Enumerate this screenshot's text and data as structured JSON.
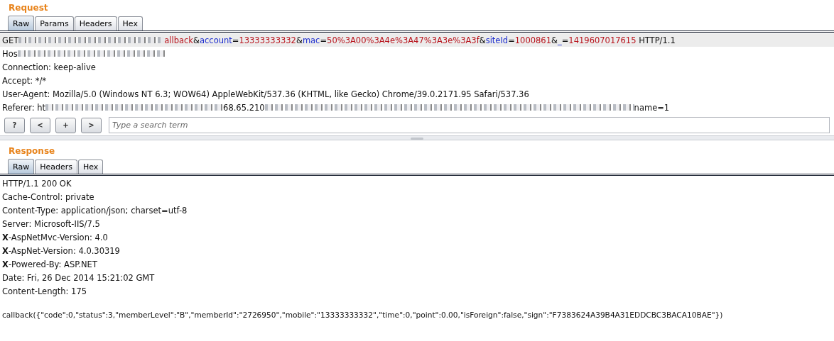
{
  "request": {
    "title": "Request",
    "tabs": [
      {
        "label": "Raw",
        "selected": true
      },
      {
        "label": "Params",
        "selected": false
      },
      {
        "label": "Headers",
        "selected": false
      },
      {
        "label": "Hex",
        "selected": false
      }
    ],
    "lines": [
      {
        "highlighted": true,
        "segments": [
          {
            "kind": "text",
            "parts": [
              {
                "kind": "plain",
                "text": "GET"
              }
            ]
          },
          {
            "kind": "redacted"
          },
          {
            "kind": "text",
            "parts": [
              {
                "kind": "value",
                "text": "allback"
              },
              {
                "kind": "plain",
                "text": "&"
              },
              {
                "kind": "name",
                "text": "account"
              },
              {
                "kind": "plain",
                "text": "="
              },
              {
                "kind": "value",
                "text": "13333333332"
              },
              {
                "kind": "plain",
                "text": "&"
              },
              {
                "kind": "name",
                "text": "mac"
              },
              {
                "kind": "plain",
                "text": "="
              },
              {
                "kind": "value",
                "text": "50%3A00%3A4e%3A47%3A3e%3A3f"
              },
              {
                "kind": "plain",
                "text": "&"
              },
              {
                "kind": "name",
                "text": "siteId"
              },
              {
                "kind": "plain",
                "text": "="
              },
              {
                "kind": "value",
                "text": "1000861"
              },
              {
                "kind": "plain",
                "text": "&"
              },
              {
                "kind": "name",
                "text": "_"
              },
              {
                "kind": "plain",
                "text": "="
              },
              {
                "kind": "value",
                "text": "1419607017615"
              },
              {
                "kind": "plain",
                "text": " HTTP/1.1"
              }
            ]
          }
        ]
      },
      {
        "highlighted": false,
        "segments": [
          {
            "kind": "text",
            "parts": [
              {
                "kind": "plain",
                "text": "Hos"
              }
            ]
          },
          {
            "kind": "redacted"
          }
        ]
      },
      {
        "highlighted": false,
        "segments": [
          {
            "kind": "text",
            "parts": [
              {
                "kind": "plain",
                "text": "Connection: keep-alive"
              }
            ]
          }
        ]
      },
      {
        "highlighted": false,
        "segments": [
          {
            "kind": "text",
            "parts": [
              {
                "kind": "plain",
                "text": "Accept: */*"
              }
            ]
          }
        ]
      },
      {
        "highlighted": false,
        "segments": [
          {
            "kind": "text",
            "parts": [
              {
                "kind": "plain",
                "text": "User-Agent: Mozilla/5.0 (Windows NT 6.3; WOW64) AppleWebKit/537.36 (KHTML, like Gecko) Chrome/39.0.2171.95 Safari/537.36"
              }
            ]
          }
        ]
      },
      {
        "highlighted": false,
        "segments": [
          {
            "kind": "text",
            "parts": [
              {
                "kind": "plain",
                "text": "Referer: ht"
              }
            ]
          },
          {
            "kind": "redacted"
          },
          {
            "kind": "text",
            "parts": [
              {
                "kind": "plain",
                "text": "68.65.210"
              }
            ]
          },
          {
            "kind": "redacted"
          },
          {
            "kind": "text",
            "parts": [
              {
                "kind": "plain",
                "text": "name=1"
              }
            ]
          }
        ]
      }
    ],
    "toolbar": {
      "buttons": [
        "?",
        "<",
        "+",
        ">"
      ],
      "search": {
        "placeholder": "Type a search term"
      }
    }
  },
  "response": {
    "title": "Response",
    "tabs": [
      {
        "label": "Raw",
        "selected": true
      },
      {
        "label": "Headers",
        "selected": false
      },
      {
        "label": "Hex",
        "selected": false
      }
    ],
    "headers": [
      "HTTP/1.1 200 OK",
      "Cache-Control: private",
      "Content-Type: application/json; charset=utf-8",
      "Server: Microsoft-IIS/7.5",
      "**X**-AspNetMvc-Version: 4.0",
      "**X**-AspNet-Version: 4.0.30319",
      "**X**-Powered-By: ASP.NET",
      "Date: Fri, 26 Dec 2014 15:21:02 GMT",
      "Content-Length: 175"
    ],
    "body": "callback({\"code\":0,\"status\":3,\"memberLevel\":\"B\",\"memberId\":\"2726950\",\"mobile\":\"13333333332\",\"time\":0,\"point\":0.00,\"isForeign\":false,\"sign\":\"F7383624A39B4A31EDDCBC3BACA10BAE\"})"
  }
}
